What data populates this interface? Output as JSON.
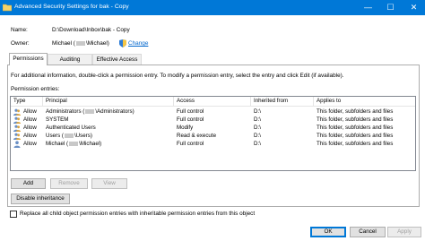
{
  "window": {
    "title": "Advanced Security Settings for bak - Copy",
    "minimize_glyph": "—",
    "maximize_glyph": "☐",
    "close_glyph": "✕"
  },
  "header": {
    "name_label": "Name:",
    "name_value": "D:\\Download\\Inbox\\bak - Copy",
    "owner_label": "Owner:",
    "owner_value_pre": "Michael (",
    "owner_value_mid": "\\Michael)",
    "change_link": "Change"
  },
  "tabs": [
    {
      "label": "Permissions",
      "active": true
    },
    {
      "label": "Auditing",
      "active": false
    },
    {
      "label": "Effective Access",
      "active": false
    }
  ],
  "permissions": {
    "info_text": "For additional information, double-click a permission entry. To modify a permission entry, select the entry and click Edit (if available).",
    "entries_label": "Permission entries:",
    "columns": [
      "Type",
      "Principal",
      "Access",
      "Inherited from",
      "Applies to"
    ],
    "rows": [
      {
        "type": "Allow",
        "principal": "Administrators (",
        "principal_tail": "\\Administrators)",
        "access": "Full control",
        "inherited_from": "D:\\",
        "applies_to": "This folder, subfolders and files"
      },
      {
        "type": "Allow",
        "principal": "SYSTEM",
        "principal_tail": "",
        "access": "Full control",
        "inherited_from": "D:\\",
        "applies_to": "This folder, subfolders and files"
      },
      {
        "type": "Allow",
        "principal": "Authenticated Users",
        "principal_tail": "",
        "access": "Modify",
        "inherited_from": "D:\\",
        "applies_to": "This folder, subfolders and files"
      },
      {
        "type": "Allow",
        "principal": "Users (",
        "principal_tail": "\\Users)",
        "access": "Read & execute",
        "inherited_from": "D:\\",
        "applies_to": "This folder, subfolders and files"
      },
      {
        "type": "Allow",
        "principal": "Michael (",
        "principal_tail": "\\Michael)",
        "access": "Full control",
        "inherited_from": "D:\\",
        "applies_to": "This folder, subfolders and files"
      }
    ],
    "add_button": "Add",
    "remove_button": "Remove",
    "view_button": "View",
    "disable_inheritance_button": "Disable inheritance",
    "replace_checkbox_label": "Replace all child object permission entries with inheritable permission entries from this object",
    "replace_checked": false
  },
  "footer": {
    "ok_button": "OK",
    "cancel_button": "Cancel",
    "apply_button": "Apply"
  },
  "colors": {
    "titlebar": "#0078d7",
    "link": "#0066cc",
    "panel_border": "#adadad"
  }
}
